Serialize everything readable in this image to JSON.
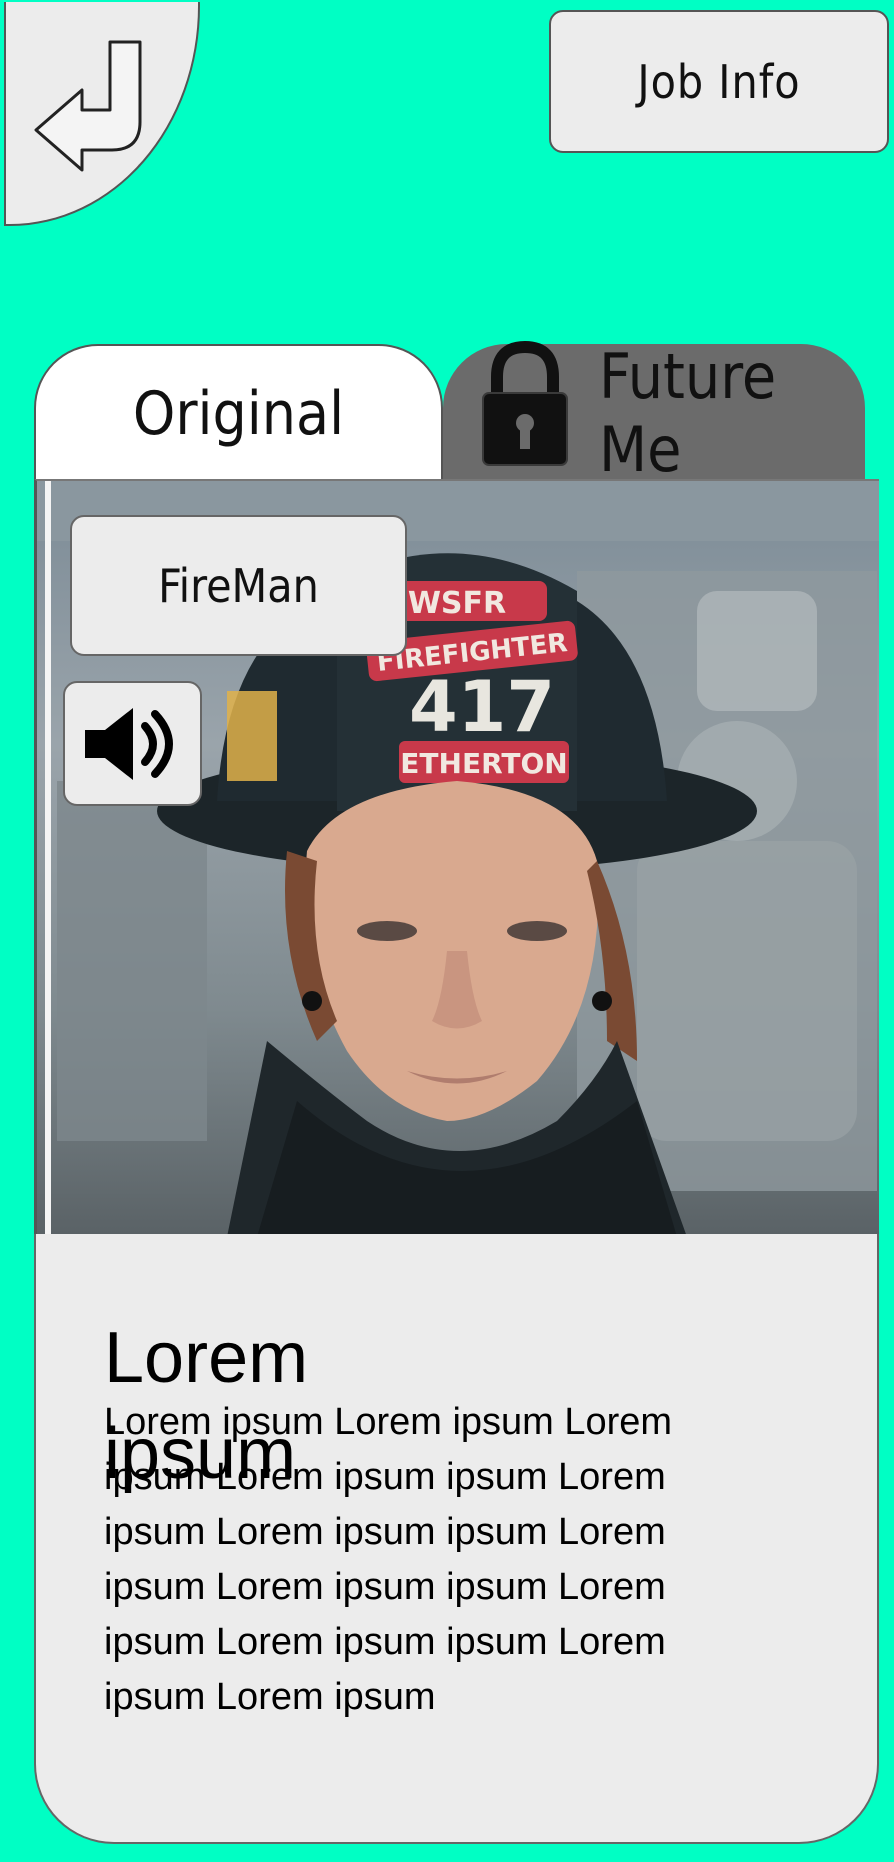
{
  "header": {
    "back_icon": "return-arrow-icon",
    "job_info_label": "Job Info"
  },
  "tabs": [
    {
      "label": "Original",
      "active": true
    },
    {
      "label": "Future Me",
      "locked": true,
      "icon": "lock-icon"
    }
  ],
  "photo": {
    "subject_label": "FireMan",
    "helmet_text": [
      "WSFR",
      "FIREFIGHTER",
      "417",
      "ETHERTON"
    ],
    "sound_icon": "speaker-icon"
  },
  "card": {
    "title": "Lorem ipsum",
    "body": "Lorem ipsum Lorem ipsum Lorem\nipsum Lorem ipsum  ipsum Lorem\nipsum Lorem ipsum  ipsum Lorem\nipsum Lorem ipsum  ipsum Lorem\nipsum Lorem ipsum  ipsum Lorem\nipsum Lorem ipsum"
  },
  "colors": {
    "background": "#00ffc4",
    "panel": "#ececec",
    "tab_locked": "#6b6b6b"
  }
}
